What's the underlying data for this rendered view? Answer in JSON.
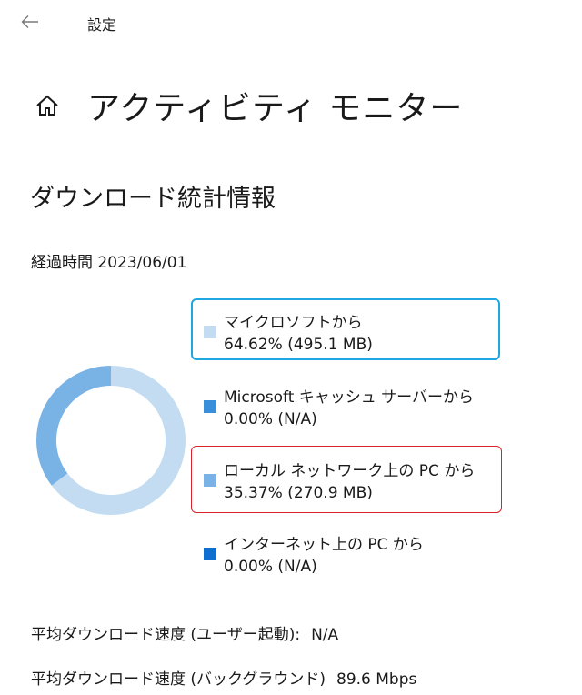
{
  "window": {
    "title": "設定"
  },
  "header": {
    "title": "アクティビティ モニター"
  },
  "download_stats": {
    "section_title": "ダウンロード統計情報",
    "elapsed": "経過時間 2023/06/01"
  },
  "chart_data": {
    "type": "pie",
    "style": "donut",
    "title": "",
    "slices": [
      {
        "label": "マイクロソフトから",
        "percent": 64.62,
        "amount_text": "64.62%  (495.1 MB)",
        "color": "#c3dcf2"
      },
      {
        "label": "Microsoft キャッシュ サーバーから",
        "percent": 0.0,
        "amount_text": "0.00%  (N/A)",
        "color": "#3a8fdb"
      },
      {
        "label": "ローカル ネットワーク上の PC から",
        "percent": 35.37,
        "amount_text": "35.37%  (270.9 MB)",
        "color": "#79b3e6"
      },
      {
        "label": "インターネット上の PC から",
        "percent": 0.0,
        "amount_text": "0.00%  (N/A)",
        "color": "#0e6fd1"
      }
    ]
  },
  "stats": {
    "avg_foreground_label": "平均ダウンロード速度 (ユーザー起動):",
    "avg_foreground_value": "N/A",
    "avg_background_label": "平均ダウンロード速度 (バックグラウンド)",
    "avg_background_value": "89.6 Mbps"
  },
  "colors": {
    "highlight_blue": "#1ea7e1",
    "highlight_red": "#d9242b"
  },
  "icons": {
    "back": "back-arrow-icon",
    "home": "home-icon"
  }
}
